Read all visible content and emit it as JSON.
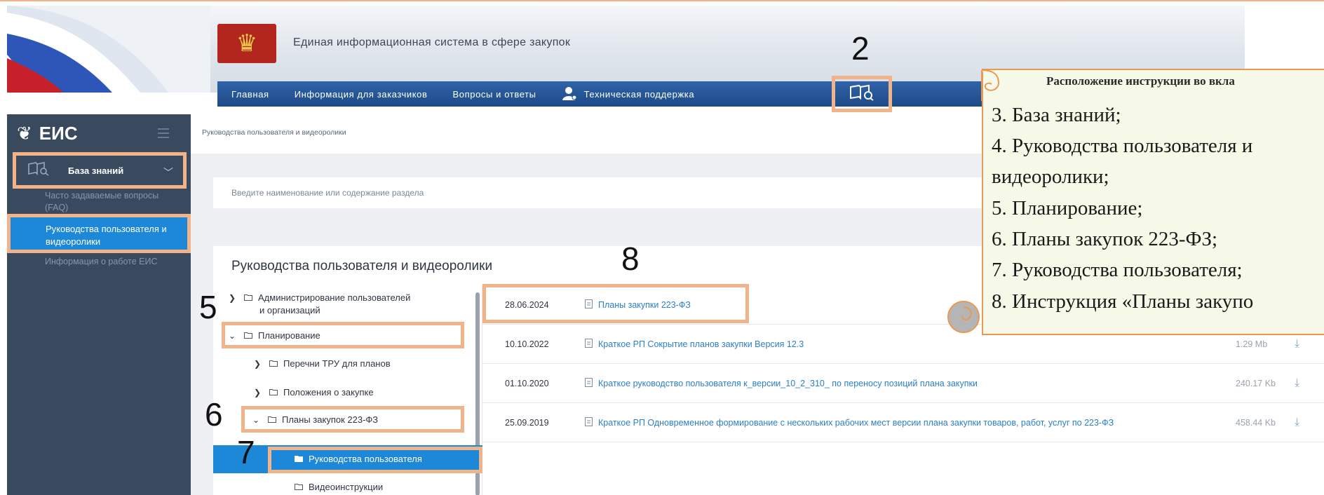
{
  "header": {
    "site_title": "Единая информационная система в сфере закупок",
    "nav": [
      "Главная",
      "Информация для заказчиков",
      "Вопросы и ответы"
    ],
    "support_label": "Техническая поддержка"
  },
  "sidebar": {
    "brand": "ЕИС",
    "knowledge_base": "База знаний",
    "items": [
      "Часто задаваемые вопросы (FAQ)",
      "Руководства пользователя и видеоролики",
      "Информация о работе ЕИС"
    ]
  },
  "main": {
    "breadcrumb": "Руководства пользователя и видеоролики",
    "search_placeholder": "Введите наименование или содержание раздела",
    "panel_title": "Руководства пользователя и видеоролики",
    "tree": [
      "Администрирование пользователей",
      "и организаций",
      "Планирование",
      "Перечни ТРУ для планов",
      "Положения о закупке",
      "Планы закупок 223-ФЗ",
      "Руководства пользователя",
      "Видеоинструкции"
    ],
    "rows": [
      {
        "date": "28.06.2024",
        "title": "Планы закупки 223-ФЗ",
        "size": ""
      },
      {
        "date": "10.10.2022",
        "title": "Краткое РП Сокрытие планов закупки Версия 12.3",
        "size": "1.29 Mb"
      },
      {
        "date": "01.10.2020",
        "title": "Краткое руководство пользователя к_версии_10_2_310_ по переносу позиций плана закупки",
        "size": "240.17 Kb"
      },
      {
        "date": "25.09.2019",
        "title": "Краткое РП Одновременное формирование с нескольких рабочих мест версии плана закупки товаров, работ, услуг по 223-ФЗ",
        "size": "458.44 Kb"
      }
    ]
  },
  "markers": {
    "n2": "2",
    "n5": "5",
    "n6": "6",
    "n7": "7",
    "n8": "8"
  },
  "callout": {
    "heading": "Расположение инструкции во вкла",
    "lines": [
      "3. База знаний;",
      "4. Руководства пользователя и",
      "видеоролики;",
      "5. Планирование;",
      "6. Планы закупок 223-ФЗ;",
      "7. Руководства пользователя;",
      "8. Инструкция «Планы закупо"
    ]
  },
  "colors": {
    "highlight": "#f0b38a",
    "nav_blue": "#2f63a8",
    "active_blue": "#1e88d8",
    "sidebar_bg": "#3a4a5e"
  }
}
